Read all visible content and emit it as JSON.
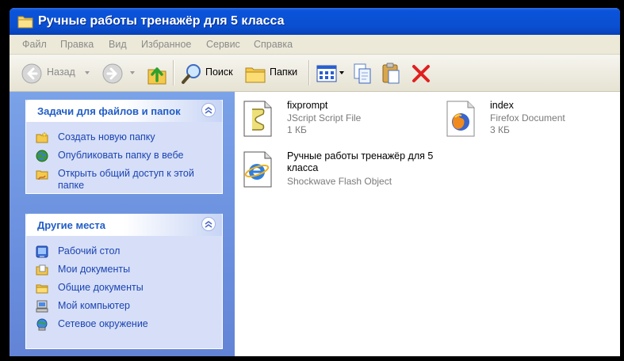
{
  "window": {
    "title": "Ручные работы тренажёр для 5 класса"
  },
  "menu": [
    "Файл",
    "Правка",
    "Вид",
    "Избранное",
    "Сервис",
    "Справка"
  ],
  "toolbar": {
    "back_label": "Назад",
    "search_label": "Поиск",
    "folders_label": "Папки"
  },
  "tasks_panel": {
    "title": "Задачи для файлов и папок",
    "items": [
      {
        "label": "Создать новую папку",
        "icon": "new-folder-icon"
      },
      {
        "label": "Опубликовать папку в вебе",
        "icon": "web-publish-icon"
      },
      {
        "label": "Открыть общий доступ к этой папке",
        "icon": "share-folder-icon"
      }
    ]
  },
  "places_panel": {
    "title": "Другие места",
    "items": [
      {
        "label": "Рабочий стол",
        "icon": "desktop-icon"
      },
      {
        "label": "Мои документы",
        "icon": "my-documents-icon"
      },
      {
        "label": "Общие документы",
        "icon": "shared-documents-icon"
      },
      {
        "label": "Мой компьютер",
        "icon": "my-computer-icon"
      },
      {
        "label": "Сетевое окружение",
        "icon": "network-icon"
      }
    ]
  },
  "files": [
    {
      "name": "fixprompt",
      "type": "JScript Script File",
      "size": "1 КБ",
      "icon": "jscript-file-icon"
    },
    {
      "name": "index",
      "type": "Firefox Document",
      "size": "3 КБ",
      "icon": "firefox-document-icon"
    },
    {
      "name": "Ручные работы тренажёр для 5 класса",
      "type": "Shockwave Flash Object",
      "size": "",
      "icon": "flash-object-icon"
    }
  ],
  "colors": {
    "titlebar": "#0a53da",
    "task_link": "#1c43b3",
    "panel_title": "#215dc6",
    "delete_red": "#e02020"
  }
}
